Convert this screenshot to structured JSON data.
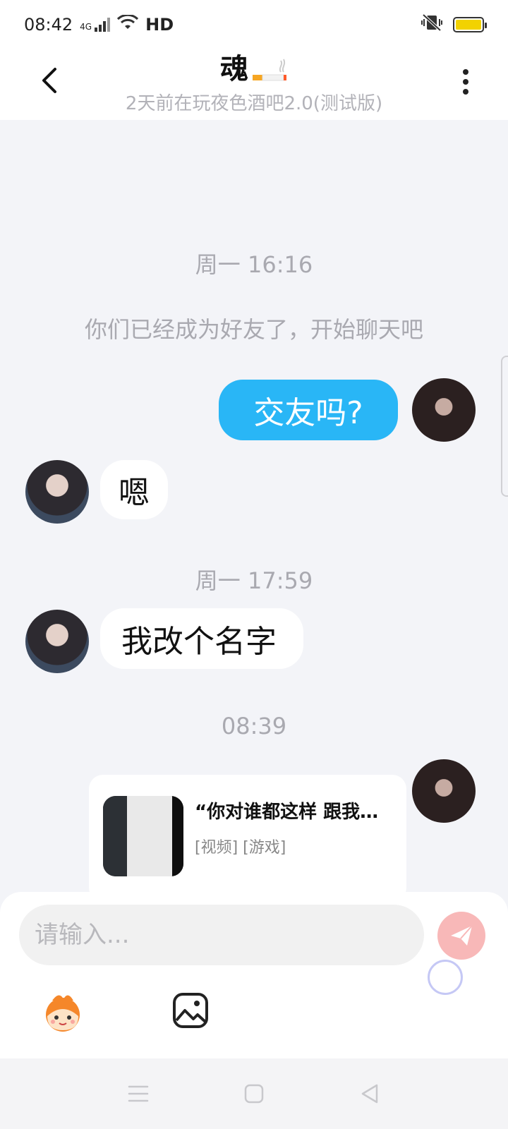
{
  "status": {
    "time": "08:42",
    "network": "4G",
    "hd": "HD"
  },
  "header": {
    "title": "魂",
    "subtitle": "2天前在玩夜色酒吧2.0(测试版)"
  },
  "chat": {
    "timestamp_1": "周一 16:16",
    "system_msg": "你们已经成为好友了，开始聊天吧",
    "msg_1": "交友吗?",
    "msg_2": "嗯",
    "timestamp_2": "周一 17:59",
    "msg_3": "我改个名字",
    "timestamp_3": "08:39",
    "share_title": "“你对谁都这样 跟我讲...",
    "share_tags": "[视频] [游戏]"
  },
  "input": {
    "placeholder": "请输入..."
  },
  "colors": {
    "my_bubble": "#29b6f6",
    "send_button": "#f8b8b8",
    "background": "#f3f4f8"
  },
  "icons": {
    "back": "chevron-left-icon",
    "more": "more-vertical-icon",
    "send": "paper-plane-icon",
    "emoji": "mascot-emoji-icon",
    "image": "image-icon"
  }
}
